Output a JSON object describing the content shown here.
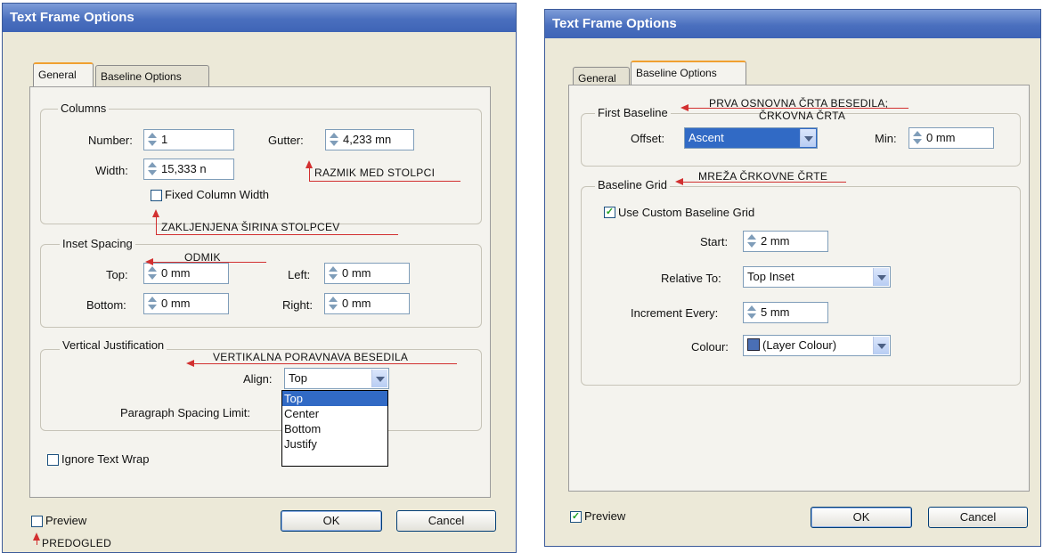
{
  "left_dialog": {
    "title": "Text Frame Options",
    "tabs": [
      {
        "label": "General"
      },
      {
        "label": "Baseline Options"
      }
    ],
    "columns": {
      "legend": "Columns",
      "number_label": "Number:",
      "number_value": "1",
      "width_label": "Width:",
      "width_value": "15,333 n",
      "gutter_label": "Gutter:",
      "gutter_value": "4,233 mn",
      "fixed_width_label": "Fixed Column Width"
    },
    "inset": {
      "legend": "Inset Spacing",
      "top_label": "Top:",
      "top_value": "0 mm",
      "bottom_label": "Bottom:",
      "bottom_value": "0 mm",
      "left_label": "Left:",
      "left_value": "0 mm",
      "right_label": "Right:",
      "right_value": "0 mm"
    },
    "vertical": {
      "legend": "Vertical Justification",
      "align_label": "Align:",
      "align_value": "Top",
      "para_label": "Paragraph Spacing Limit:",
      "options": [
        "Top",
        "Center",
        "Bottom",
        "Justify"
      ]
    },
    "ignore_wrap_label": "Ignore Text Wrap",
    "preview_label": "Preview",
    "preview_checked": false,
    "ok_label": "OK",
    "cancel_label": "Cancel"
  },
  "right_dialog": {
    "title": "Text Frame Options",
    "tabs": [
      {
        "label": "General"
      },
      {
        "label": "Baseline Options"
      }
    ],
    "first_baseline": {
      "legend": "First Baseline",
      "offset_label": "Offset:",
      "offset_value": "Ascent",
      "min_label": "Min:",
      "min_value": "0 mm"
    },
    "grid": {
      "legend": "Baseline Grid",
      "use_custom_label": "Use Custom Baseline Grid",
      "use_custom_checked": true,
      "start_label": "Start:",
      "start_value": "2 mm",
      "relative_label": "Relative To:",
      "relative_value": "Top Inset",
      "increment_label": "Increment Every:",
      "increment_value": "5 mm",
      "colour_label": "Colour:",
      "colour_value": "(Layer Colour)"
    },
    "preview_label": "Preview",
    "preview_checked": true,
    "ok_label": "OK",
    "cancel_label": "Cancel"
  },
  "annotations": {
    "gutter": "RAZMIK MED STOLPCI",
    "fixed": "ZAKLJENJENA ŠIRINA STOLPCEV",
    "inset": "ODMIK",
    "vertical": "VERTIKALNA PORAVNAVA BESEDILA",
    "preview": "PREDOGLED",
    "first_baseline_1": "PRVA OSNOVNA ČRTA BESEDILA;",
    "first_baseline_2": "ČRKOVNA ČRTA",
    "grid": "MREŽA ČRKOVNE ČRTE"
  },
  "colors": {
    "title_bar": "#4a6fbe",
    "dialog_bg": "#ece9d8",
    "annotation": "#d23030",
    "selection": "#316ac5"
  }
}
